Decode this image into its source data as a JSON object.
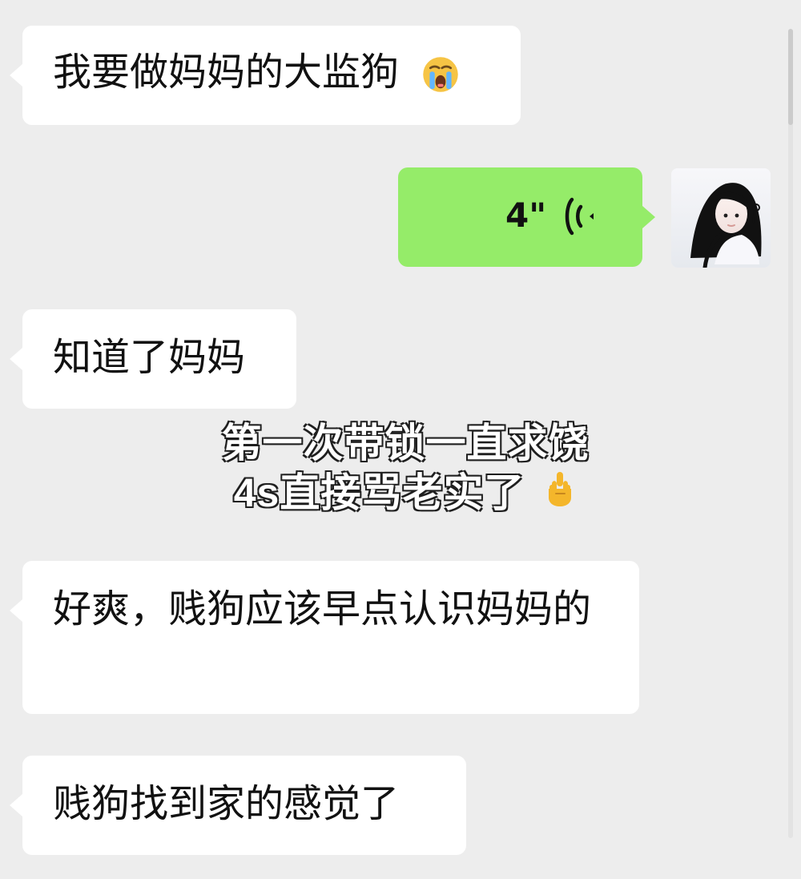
{
  "chat": {
    "messages": [
      {
        "side": "left",
        "text_before": "我要做妈妈的大监狗",
        "emoji": "loudly-crying-face-icon"
      },
      {
        "side": "right",
        "voice_duration": "4\"",
        "voice_icon": "voice-waves-icon",
        "avatar": "avatar-girl"
      },
      {
        "side": "left",
        "text": "知道了妈妈"
      },
      {
        "side": "left",
        "text": "好爽，贱狗应该早点认识妈妈的"
      },
      {
        "side": "left",
        "text": "贱狗找到家的感觉了"
      }
    ],
    "overlay": {
      "line1": "第一次带锁一直求饶",
      "line2": "4s直接骂老实了",
      "emoji": "middle-finger-icon"
    }
  }
}
